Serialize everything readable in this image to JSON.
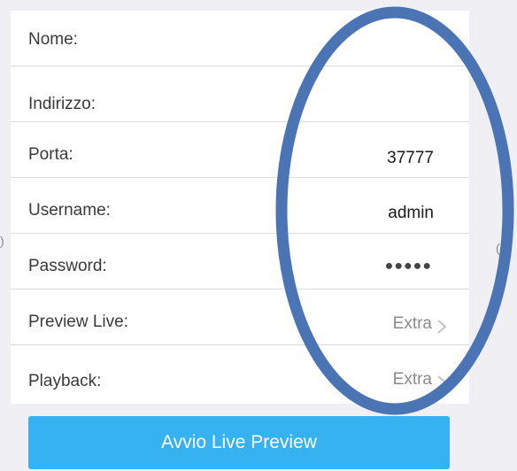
{
  "form": {
    "rows": [
      {
        "label": "Nome:",
        "value": ""
      },
      {
        "label": "Indirizzo:",
        "value": ""
      },
      {
        "label": "Porta:",
        "value": "37777"
      },
      {
        "label": "Username:",
        "value": "admin"
      },
      {
        "label": "Password:",
        "value": "●●●●●"
      },
      {
        "label": "Preview Live:",
        "value": "Extra"
      },
      {
        "label": "Playback:",
        "value": "Extra"
      }
    ]
  },
  "actions": {
    "live_preview_label": "Avvio Live Preview"
  },
  "icons": {
    "chevron": "chevron-right-icon"
  },
  "colors": {
    "accent": "#36b2f1",
    "annotation": "#4a74b4",
    "background": "#efeff4"
  }
}
